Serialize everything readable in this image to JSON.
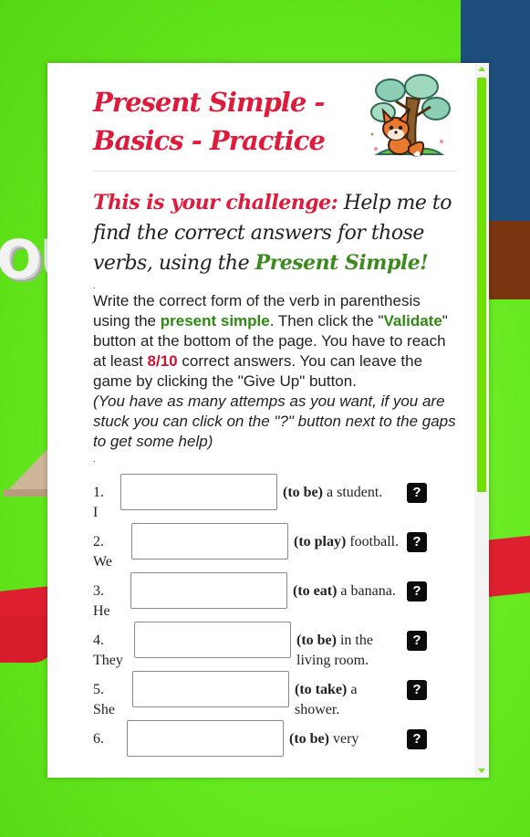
{
  "title": "Present Simple - Basics - Practice",
  "challenge": {
    "lead": "This is your challenge:",
    "text": " Help me to find the correct answers for those verbs, using the ",
    "highlight": "Present Simple!"
  },
  "dot": ".",
  "instructions": {
    "p1": "Write the correct form of the verb in parenthesis using the ",
    "present_simple": "present simple",
    "p2": ". Then click the \"",
    "validate": "Validate",
    "p3": "\" button at the bottom of the page. You have to reach at least ",
    "score": "8/10",
    "p4": " correct answers. You can leave the game by clicking the \"Give Up\" button.",
    "italic": "(You have as many attemps as you want, if you are stuck you can click on the \"?\" button next to the gaps to get some help)"
  },
  "dot2": ".",
  "questions": [
    {
      "num": "1.",
      "subject": "I",
      "verb": "(to be)",
      "rest": " a student.",
      "value": ""
    },
    {
      "num": "2.",
      "subject": "We",
      "verb": "(to play)",
      "rest": " football.",
      "value": ""
    },
    {
      "num": "3.",
      "subject": "He",
      "verb": "(to eat)",
      "rest": " a banana.",
      "value": ""
    },
    {
      "num": "4.",
      "subject": "They",
      "verb": "(to be)",
      "rest": " in the living room.",
      "value": ""
    },
    {
      "num": "5.",
      "subject": "She",
      "verb": "(to take)",
      "rest": " a shower.",
      "value": ""
    },
    {
      "num": "6.",
      "subject": "",
      "verb": "(to be)",
      "rest": " very",
      "value": ""
    }
  ],
  "help_label": "?",
  "background_text": "OU",
  "colors": {
    "title_red": "#dd1c3c",
    "green": "#3c8a1e",
    "scroll_green": "#6fe000",
    "bg_green": "#66ee22"
  }
}
